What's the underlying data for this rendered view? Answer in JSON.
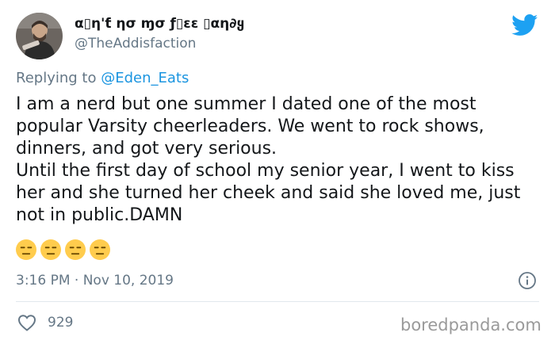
{
  "tweet": {
    "author_name": "α▯η'ƭ ησ ɱσ ƒ▯εε ▯αη∂ყ",
    "author_handle": "@TheAddisfaction",
    "reply_prefix": "Replying to ",
    "reply_to": "@Eden_Eats",
    "body": "I am a nerd but one summer I dated one of the most popular Varsity cheerleaders. We went to rock shows, dinners, and got very serious.\nUntil the first day of school my senior year, I went to kiss her and she turned her cheek and said she loved me, just not in public.DAMN",
    "emojis": [
      "expressionless-face",
      "expressionless-face",
      "expressionless-face",
      "expressionless-face"
    ],
    "timestamp": "3:16 PM · Nov 10, 2019",
    "like_count": "929"
  },
  "colors": {
    "twitter_blue": "#1da1f2",
    "mention_blue": "#1b95e0",
    "secondary_text": "#657786",
    "emoji_yellow": "#ffcc4d"
  },
  "watermark": "boredpanda.com"
}
